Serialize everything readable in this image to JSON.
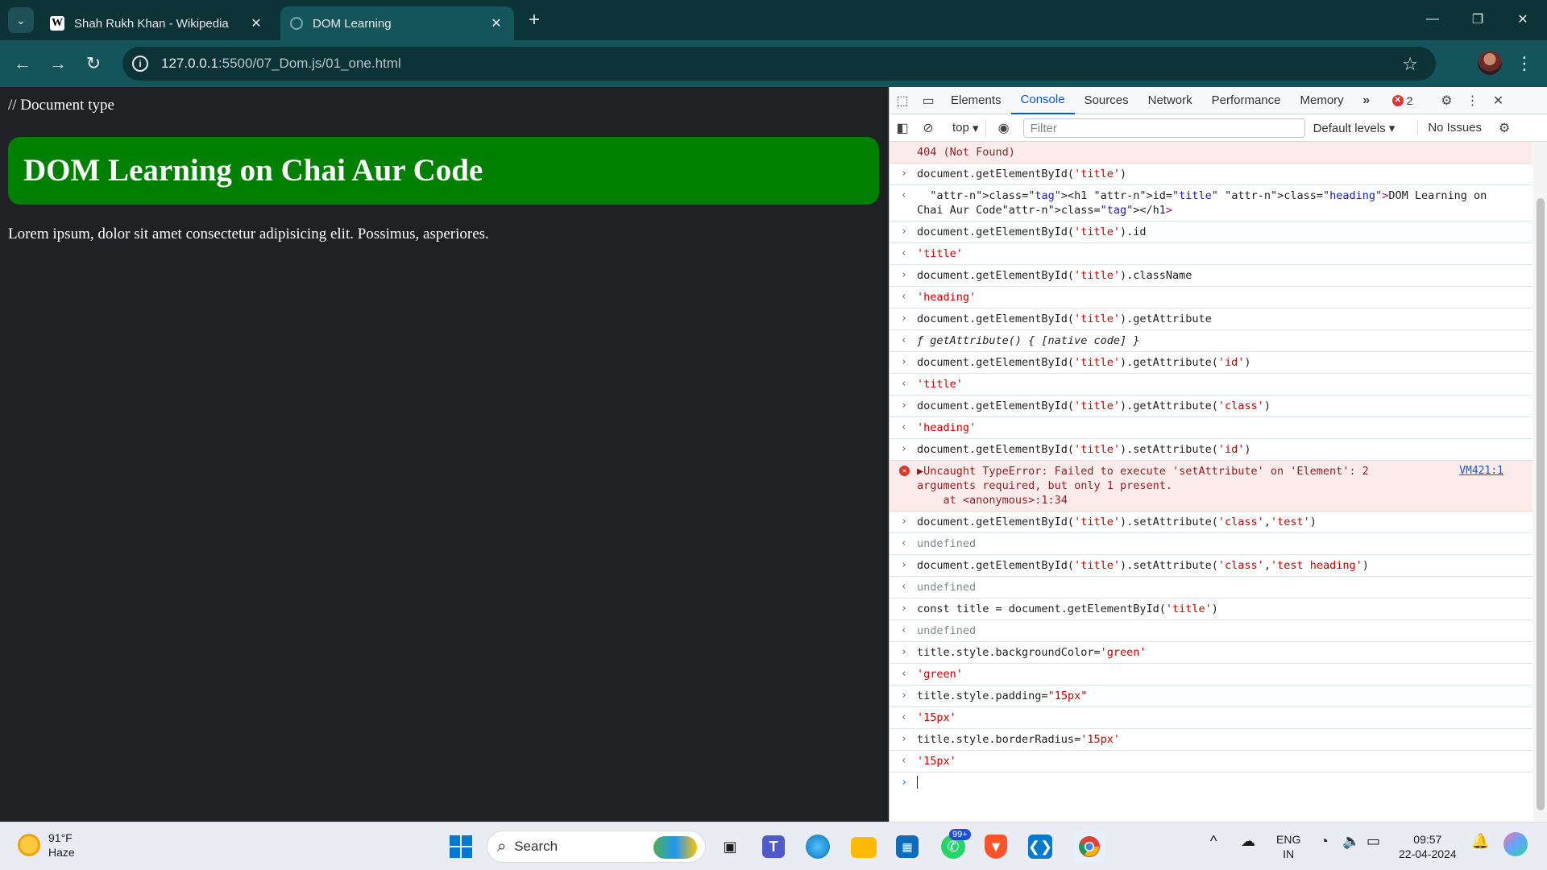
{
  "browser": {
    "tabs": [
      {
        "title": "Shah Rukh Khan - Wikipedia",
        "favicon": "W",
        "active": false
      },
      {
        "title": "DOM Learning",
        "active": true
      }
    ],
    "url_host": "127.0.0.1",
    "url_rest": ":5500/07_Dom.js/01_one.html"
  },
  "page": {
    "comment": "// Document type",
    "heading": "DOM Learning on Chai Aur Code",
    "heading_bg": "#008000",
    "paragraph": "Lorem ipsum, dolor sit amet consectetur adipisicing elit. Possimus, asperiores."
  },
  "devtools": {
    "tabs": [
      "Elements",
      "Console",
      "Sources",
      "Network",
      "Performance",
      "Memory"
    ],
    "active_tab": "Console",
    "error_count": "2",
    "context": "top",
    "filter_placeholder": "Filter",
    "levels": "Default levels",
    "issues": "No Issues",
    "console_lines": [
      {
        "kind": "error-tail",
        "text": "404 (Not Found)"
      },
      {
        "kind": "in",
        "text": "document.getElementById('title')"
      },
      {
        "kind": "out-html",
        "text": "<h1 id=\"title\" class=\"heading\">DOM Learning on Chai Aur Code</h1>"
      },
      {
        "kind": "in",
        "text": "document.getElementById('title').id"
      },
      {
        "kind": "out-str",
        "text": "'title'"
      },
      {
        "kind": "in",
        "text": "document.getElementById('title').className"
      },
      {
        "kind": "out-str",
        "text": "'heading'"
      },
      {
        "kind": "in",
        "text": "document.getElementById('title').getAttribute"
      },
      {
        "kind": "out-fn",
        "text": "ƒ getAttribute() { [native code] }"
      },
      {
        "kind": "in",
        "text": "document.getElementById('title').getAttribute('id')"
      },
      {
        "kind": "out-str",
        "text": "'title'"
      },
      {
        "kind": "in",
        "text": "document.getElementById('title').getAttribute('class')"
      },
      {
        "kind": "out-str",
        "text": "'heading'"
      },
      {
        "kind": "in",
        "text": "document.getElementById('title').setAttribute('id')"
      },
      {
        "kind": "error",
        "text": "▶Uncaught TypeError: Failed to execute 'setAttribute' on 'Element': 2\narguments required, but only 1 present.\n    at <anonymous>:1:34",
        "link": "VM421:1"
      },
      {
        "kind": "in",
        "text": "document.getElementById('title').setAttribute('class','test')"
      },
      {
        "kind": "out-undef",
        "text": "undefined"
      },
      {
        "kind": "in",
        "text": "document.getElementById('title').setAttribute('class','test heading')"
      },
      {
        "kind": "out-undef",
        "text": "undefined"
      },
      {
        "kind": "in",
        "text": "const title = document.getElementById('title')"
      },
      {
        "kind": "out-undef",
        "text": "undefined"
      },
      {
        "kind": "in",
        "text": "title.style.backgroundColor='green'"
      },
      {
        "kind": "out-str",
        "text": "'green'"
      },
      {
        "kind": "in",
        "text": "title.style.padding=\"15px\""
      },
      {
        "kind": "out-str",
        "text": "'15px'"
      },
      {
        "kind": "in",
        "text": "title.style.borderRadius='15px'"
      },
      {
        "kind": "out-str",
        "text": "'15px'"
      }
    ]
  },
  "taskbar": {
    "temp": "91°F",
    "condition": "Haze",
    "search_label": "Search",
    "badge": "99+",
    "lang1": "ENG",
    "lang2": "IN",
    "time": "09:57",
    "date": "22-04-2024"
  }
}
